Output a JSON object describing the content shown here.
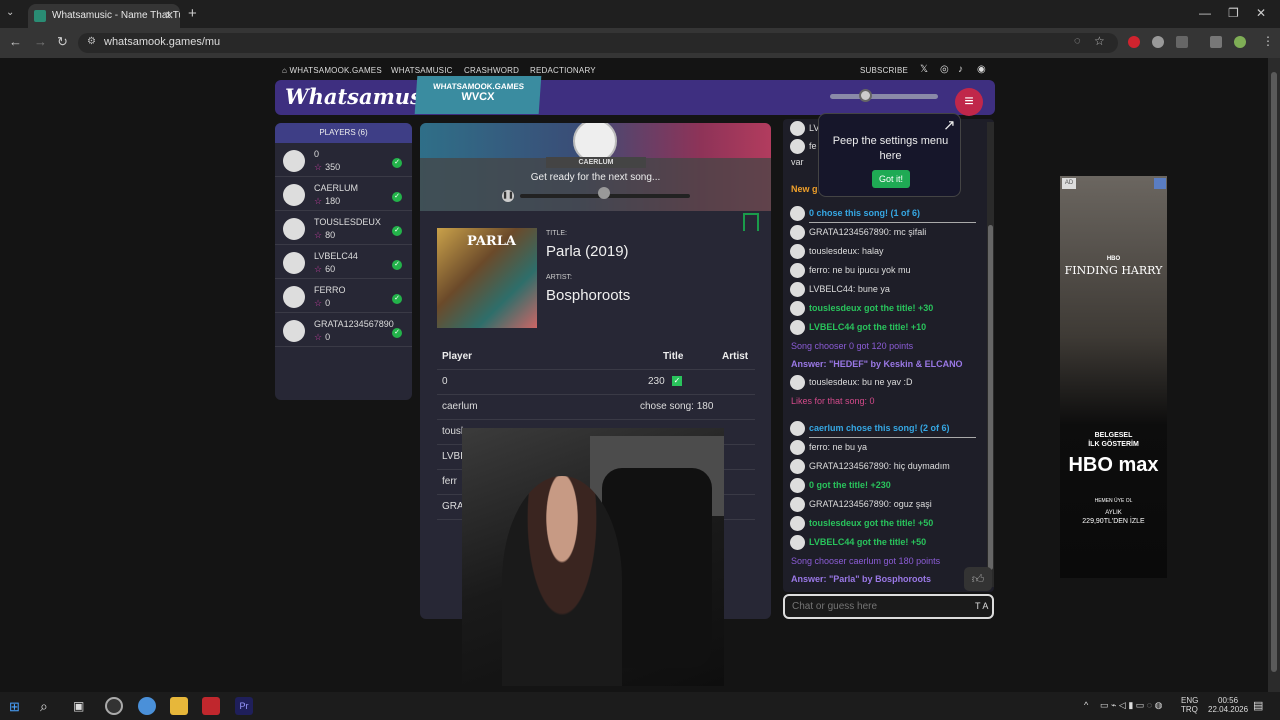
{
  "browser": {
    "tab_title": "Whatsamusic - Name That Tune",
    "url": "whatsamook.games/mu"
  },
  "topnav": {
    "home": "WHATSAMOOK.GAMES",
    "links": [
      "WHATSAMUSIC",
      "CRASHWORD",
      "REDACTIONARY"
    ],
    "subscribe": "SUBSCRIBE"
  },
  "header": {
    "logo": "Whatsamusic",
    "room_site": "WHATSAMOOK.GAMES",
    "room_code": "WVCX"
  },
  "players": {
    "title": "PLAYERS (6)",
    "list": [
      {
        "name": "0",
        "score": "350"
      },
      {
        "name": "CAERLUM",
        "score": "180"
      },
      {
        "name": "TOUSLESDEUX",
        "score": "80"
      },
      {
        "name": "LVBELC44",
        "score": "60"
      },
      {
        "name": "FERRO",
        "score": "0"
      },
      {
        "name": "GRATA1234567890",
        "score": "0"
      }
    ]
  },
  "stage": {
    "chooser": "CAERLUM",
    "status": "Get ready for the next song...",
    "progress": 0.48,
    "title_label": "TITLE:",
    "title": "Parla (2019)",
    "artist_label": "ARTIST:",
    "artist": "Bosphoroots",
    "cover_text": "PARLA"
  },
  "scoretable": {
    "headers": [
      "Player",
      "Title",
      "Artist"
    ],
    "rows": [
      {
        "player": "0",
        "title": "230",
        "artist": ""
      },
      {
        "player": "caerlum",
        "title": "chose song: 180",
        "artist": ""
      },
      {
        "player": "tousl",
        "title": "",
        "artist": ""
      },
      {
        "player": "LVBI",
        "title": "",
        "artist": ""
      },
      {
        "player": "ferr",
        "title": "",
        "artist": ""
      },
      {
        "player": "GRA",
        "title": "",
        "artist": ""
      }
    ]
  },
  "chat": {
    "top_rows": [
      {
        "text": "LV"
      },
      {
        "text": "fe"
      },
      {
        "text": "var"
      },
      {
        "text": "New g"
      }
    ],
    "rows": [
      {
        "kind": "chooser",
        "text": "0 chose this song! (1 of 6)"
      },
      {
        "kind": "msg",
        "text": "GRATA1234567890: mc şifali"
      },
      {
        "kind": "msg",
        "text": "touslesdeux: halay"
      },
      {
        "kind": "msg",
        "text": "ferro: ne bu ipucu yok mu"
      },
      {
        "kind": "msg",
        "text": "LVBELC44: bune ya"
      },
      {
        "kind": "got",
        "text": "touslesdeux got the title! +30"
      },
      {
        "kind": "got",
        "text": "LVBELC44 got the title! +10"
      },
      {
        "kind": "info",
        "text": "Song chooser 0 got 120 points"
      },
      {
        "kind": "answer",
        "text": "Answer: \"HEDEF\" by Keskin & ELCANO"
      },
      {
        "kind": "msg",
        "text": "touslesdeux: bu ne yav :D"
      },
      {
        "kind": "likes",
        "text": "Likes for that song: 0"
      },
      {
        "kind": "chooser",
        "text": "caerlum chose this song! (2 of 6)"
      },
      {
        "kind": "msg",
        "text": "ferro: ne bu ya"
      },
      {
        "kind": "msg",
        "text": "GRATA1234567890: hiç duymadım"
      },
      {
        "kind": "got",
        "text": "0 got the title! +230"
      },
      {
        "kind": "msg",
        "text": "GRATA1234567890: oguz şaşi"
      },
      {
        "kind": "got",
        "text": "touslesdeux got the title! +50"
      },
      {
        "kind": "got",
        "text": "LVBELC44 got the title! +50"
      },
      {
        "kind": "info",
        "text": "Song chooser caerlum got 180 points"
      },
      {
        "kind": "answer",
        "text": "Answer: \"Parla\" by Bosphoroots"
      }
    ],
    "input_placeholder": "Chat or guess here",
    "input_icons": "T A"
  },
  "tooltip": {
    "message": "Peep the settings menu here",
    "button": "Got it!"
  },
  "ad": {
    "tag": "AD",
    "movie": "FINDING HARRY",
    "small1": "BELGESEL",
    "small2": "İLK GÖSTERİM",
    "brand": "HBO max",
    "cta": "HEMEN ÜYE OL",
    "price_line1": "AYLIK",
    "price_line2": "229,90TL'DEN İZLE"
  },
  "taskbar": {
    "lang1": "ENG",
    "lang2": "TRQ",
    "time": "00:56",
    "date": "22.04.2026"
  },
  "colors": {
    "header": "#3e2f80",
    "accent_green": "#29c35c",
    "accent_cyan": "#36a7e3",
    "accent_purple": "#8b5cd6",
    "menu_red": "#c0274a"
  }
}
